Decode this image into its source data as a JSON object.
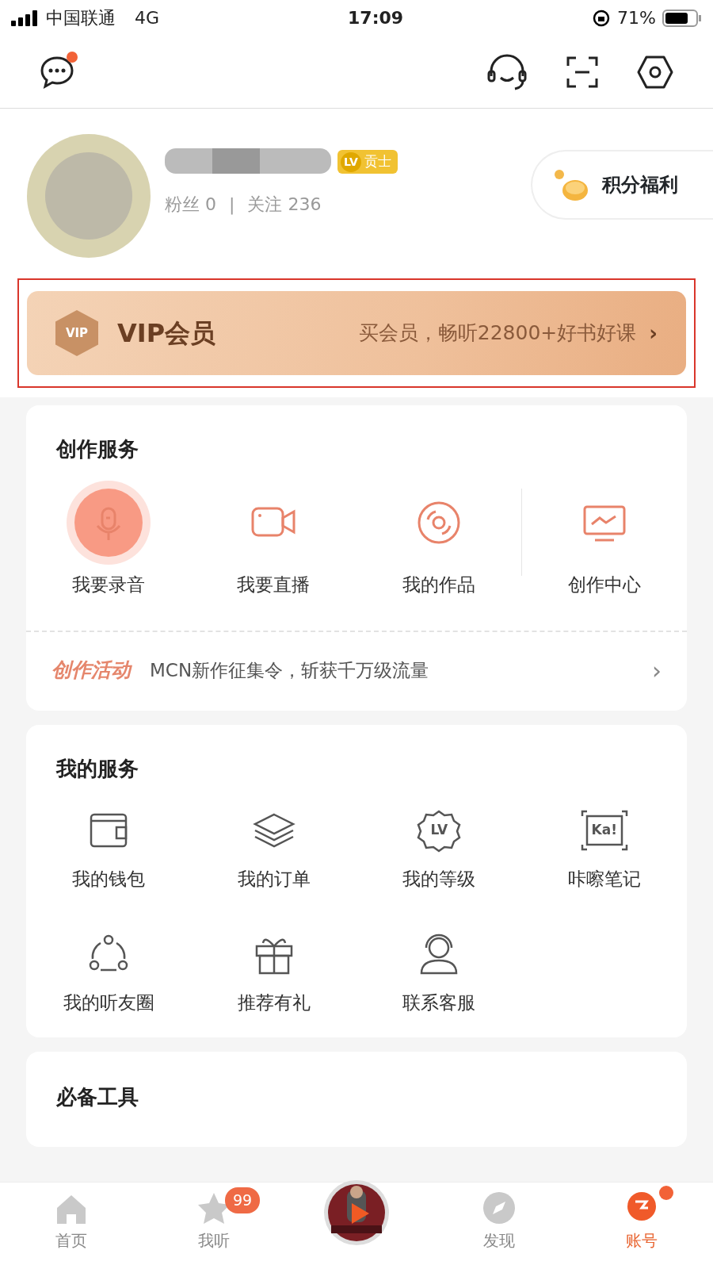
{
  "status_bar": {
    "carrier": "中国联通",
    "network": "4G",
    "time": "17:09",
    "battery": "71%"
  },
  "profile": {
    "followers": "粉丝 0",
    "separator": "|",
    "following": "关注 236",
    "level_badge": "LV",
    "level_title": "贡士",
    "points_button": "积分福利"
  },
  "vip_banner": {
    "badge": "VIP",
    "title": "VIP会员",
    "subtitle": "买会员，畅听22800+好书好课",
    "chevron": "›",
    "highlighted": true
  },
  "creation": {
    "title": "创作服务",
    "items": [
      {
        "label": "我要录音",
        "highlighted": true
      },
      {
        "label": "我要直播",
        "highlighted": false
      },
      {
        "label": "我的作品",
        "highlighted": false
      },
      {
        "label": "创作中心",
        "highlighted": false
      }
    ],
    "activity_tag": "创作活动",
    "activity_text": "MCN新作征集令，斩获千万级流量",
    "activity_chevron": "›"
  },
  "services": {
    "title": "我的服务",
    "items": [
      {
        "label": "我的钱包"
      },
      {
        "label": "我的订单"
      },
      {
        "label": "我的等级",
        "icon_text": "LV"
      },
      {
        "label": "咔嚓笔记",
        "icon_text": "Ka!"
      },
      {
        "label": "我的听友圈"
      },
      {
        "label": "推荐有礼"
      },
      {
        "label": "联系客服"
      }
    ]
  },
  "tools": {
    "title": "必备工具"
  },
  "tab_bar": [
    {
      "kind": "tab",
      "label": "首页",
      "selected": false,
      "unread_dot": false
    },
    {
      "kind": "tab",
      "label": "我听",
      "selected": false,
      "badge": "99",
      "unread_dot": false
    },
    {
      "kind": "player"
    },
    {
      "kind": "tab",
      "label": "发现",
      "selected": false,
      "unread_dot": false
    },
    {
      "kind": "tab",
      "label": "账号",
      "selected": true,
      "unread_dot": true
    }
  ],
  "message_unread": true
}
